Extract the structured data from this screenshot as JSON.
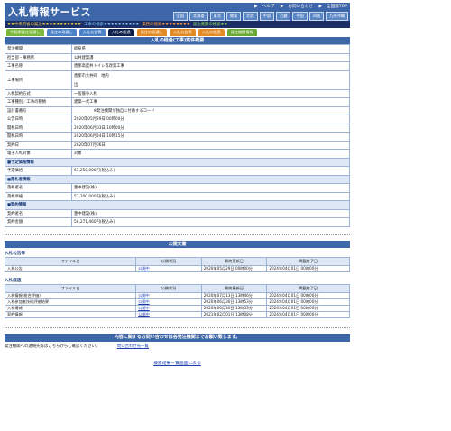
{
  "header": {
    "title": "入札情報サービス",
    "links": [
      "ヘルプ",
      "お問い合わせ",
      "全国版TOP"
    ],
    "regions": [
      "全国",
      "北海道",
      "東北",
      "関東",
      "北陸",
      "中部",
      "近畿",
      "中国",
      "四国",
      "九州沖縄"
    ]
  },
  "categories": [
    "中央府省の発注",
    "工事の検索",
    "業務の検索",
    "発注機関の検索"
  ],
  "tabs": [
    {
      "label": "中長期発注見通し",
      "style": "t-g"
    },
    {
      "label": "発注の見通し",
      "style": "t-b"
    },
    {
      "label": "入札公告等",
      "style": "t-b"
    },
    {
      "label": "入札の経過",
      "style": "t-dk"
    },
    {
      "label": "発注の見通し",
      "style": "t-o"
    },
    {
      "label": "入札公告等",
      "style": "t-o"
    },
    {
      "label": "入札の経過",
      "style": "t-o"
    },
    {
      "label": "発注機関情報",
      "style": "t-gr"
    }
  ],
  "detail": {
    "title": "入札の経過(工事)案件概要",
    "rows": [
      {
        "label": "発注機関",
        "value": "岐阜県"
      },
      {
        "label": "担当部・事務所",
        "value": "公共建築課"
      },
      {
        "label": "工事名称",
        "value": "恵那高度共トイレ等改築工事"
      },
      {
        "label": "工事場所",
        "value": "恵那市大井町　地内",
        "value2": "出",
        "tall": true
      },
      {
        "label": "入札契約方式",
        "value": "一般競争入札"
      },
      {
        "label": "工事種別／工事の種類",
        "value": "建築一式工事"
      },
      {
        "label": "設計書番号",
        "value": "　　　　　※発注機関が独自に付番するコード"
      },
      {
        "label": "公告日時",
        "value": "2020年05月29日 00時00分"
      },
      {
        "label": "開札日時",
        "value": "2020年06月03日 10時00分"
      },
      {
        "label": "開札日時",
        "value": "2020年06月24日 10時15分"
      },
      {
        "label": "契約日",
        "value": "2020年07月06日"
      },
      {
        "label": "電子入札対象",
        "value": "対象"
      },
      {
        "group": "■予定価格情報"
      },
      {
        "label": "予定価格",
        "value": "61,250,000円(税込み)"
      },
      {
        "group": "■落札者情報"
      },
      {
        "label": "落札者名",
        "value": "豊中建設(株)"
      },
      {
        "label": "落札価格",
        "value": "57,200,000円(税込み)"
      },
      {
        "group": "■契約情報"
      },
      {
        "label": "契約者名",
        "value": "豊中建設(株)"
      },
      {
        "label": "契約金額",
        "value": "58,271,460円(税込み)"
      }
    ]
  },
  "public_docs": {
    "title": "公開文書",
    "headers": [
      "ファイル名",
      "公開状況",
      "最終更新日",
      "掲載終了日"
    ],
    "notice_section": {
      "label": "入札公告等",
      "rows": [
        [
          "入札公告",
          "公開中",
          "2020年05月29日 00時00分",
          "2024年04月01日 00時00分"
        ]
      ]
    },
    "progress_section": {
      "label": "入札経過",
      "rows": [
        [
          "入札情報(総合評価)",
          "公開中",
          "2020年07月13日 13時46分",
          "2024年04月01日 00時00分"
        ],
        [
          "入札参加者技術評価結果",
          "公開中",
          "2020年06月30日 13時53分",
          "2024年04月01日 00時00分"
        ],
        [
          "入札情報",
          "公開中",
          "2020年06月30日 13時53分",
          "2024年04月01日 00時00分"
        ],
        [
          "契約情報",
          "公開中",
          "2021年02月01日 13時08分",
          "2024年04月01日 00時00分"
        ]
      ]
    }
  },
  "notice": "内容に関するお問い合わせは各発注機関までお願い致します。",
  "contact": {
    "text": "発注機関への連絡先等はこちらからご確認ください。",
    "link": "問い合わせ先一覧"
  },
  "back_link": "検索結果一覧画面に戻る"
}
